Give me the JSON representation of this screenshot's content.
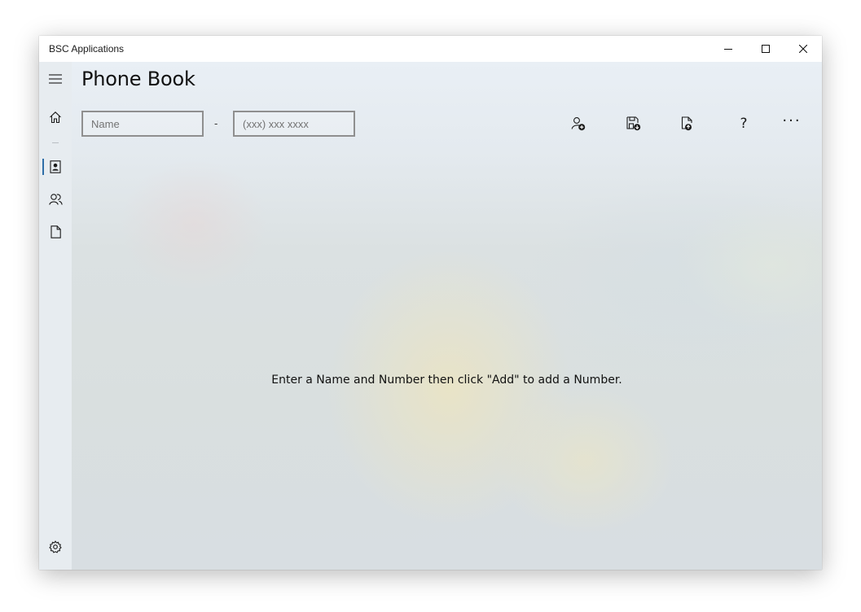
{
  "window": {
    "title": "BSC Applications",
    "controls": {
      "minimize": "minimize",
      "maximize": "maximize",
      "close": "close"
    }
  },
  "sidebar": {
    "items": [
      {
        "id": "menu",
        "icon": "hamburger-menu-icon"
      },
      {
        "id": "home",
        "icon": "home-icon"
      },
      {
        "id": "phone-book",
        "icon": "contact-card-icon",
        "selected": true
      },
      {
        "id": "contacts",
        "icon": "people-icon"
      },
      {
        "id": "documents",
        "icon": "document-icon"
      },
      {
        "id": "settings",
        "icon": "gear-icon"
      }
    ]
  },
  "page": {
    "title": "Phone Book",
    "name_field": {
      "placeholder": "Name",
      "value": ""
    },
    "separator": "-",
    "number_field": {
      "placeholder": "(xxx) xxx xxxx",
      "value": ""
    },
    "commands": [
      {
        "id": "add",
        "icon": "add-contact-icon"
      },
      {
        "id": "save",
        "icon": "save-icon"
      },
      {
        "id": "open",
        "icon": "open-file-icon"
      },
      {
        "id": "help",
        "icon": "help-icon",
        "glyph": "?"
      },
      {
        "id": "more",
        "icon": "more-icon",
        "glyph": "···"
      }
    ],
    "empty_message": "Enter a Name and Number then click \"Add\" to add a Number."
  },
  "colors": {
    "accent": "#2f6ea8",
    "sidebar_bg": "#e7ecf0",
    "field_border": "#8f8f8f"
  }
}
